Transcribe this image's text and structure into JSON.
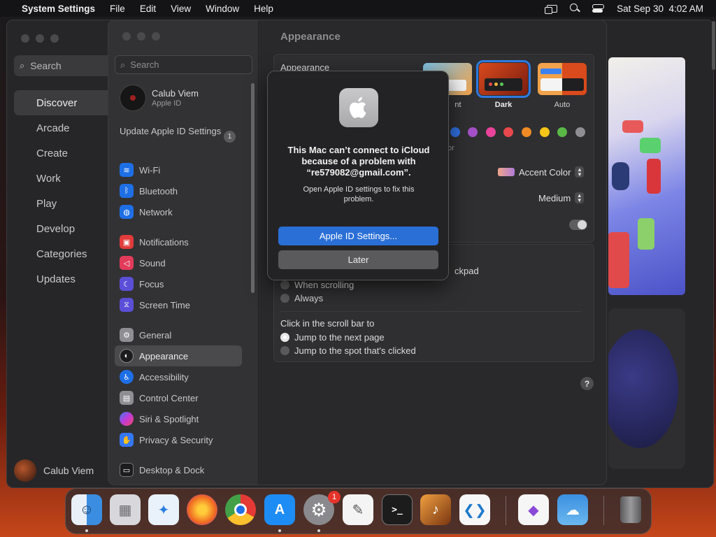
{
  "menubar": {
    "app_name": "System Settings",
    "menus": [
      "File",
      "Edit",
      "View",
      "Window",
      "Help"
    ],
    "datetime": "Sat Sep 30  4:02 AM"
  },
  "appstore": {
    "search_placeholder": "Search",
    "nav": [
      "Discover",
      "Arcade",
      "Create",
      "Work",
      "Play",
      "Develop",
      "Categories",
      "Updates"
    ],
    "active": "Discover",
    "user_name": "Calub Viem"
  },
  "settings": {
    "search_placeholder": "Search",
    "user": {
      "name": "Calub Viem",
      "sub": "Apple ID"
    },
    "update": {
      "label": "Update Apple ID Settings",
      "count": "1"
    },
    "groups": [
      [
        {
          "label": "Wi-Fi",
          "icon": "wifi-icon",
          "color": "#1e6fe6"
        },
        {
          "label": "Bluetooth",
          "icon": "bluetooth-icon",
          "color": "#1e6fe6"
        },
        {
          "label": "Network",
          "icon": "network-icon",
          "color": "#1e6fe6"
        }
      ],
      [
        {
          "label": "Notifications",
          "icon": "notifications-icon",
          "color": "#e23b3b"
        },
        {
          "label": "Sound",
          "icon": "sound-icon",
          "color": "#e23b5a"
        },
        {
          "label": "Focus",
          "icon": "focus-icon",
          "color": "#5b4fd8"
        },
        {
          "label": "Screen Time",
          "icon": "screen-time-icon",
          "color": "#5b4fd8"
        }
      ],
      [
        {
          "label": "General",
          "icon": "general-icon",
          "color": "#8e8e93"
        },
        {
          "label": "Appearance",
          "icon": "appearance-icon",
          "color": "#1c1c1e"
        },
        {
          "label": "Accessibility",
          "icon": "accessibility-icon",
          "color": "#1e6fe6"
        },
        {
          "label": "Control Center",
          "icon": "control-center-icon",
          "color": "#8e8e93"
        },
        {
          "label": "Siri & Spotlight",
          "icon": "siri-icon",
          "color": "#b33ad6"
        },
        {
          "label": "Privacy & Security",
          "icon": "privacy-icon",
          "color": "#3478f6"
        }
      ],
      [
        {
          "label": "Desktop & Dock",
          "icon": "desktop-dock-icon",
          "color": "#1c1c1e"
        }
      ]
    ],
    "active": "Appearance",
    "main": {
      "title": "Appearance",
      "appearance_label": "Appearance",
      "themes": [
        {
          "label": "nt",
          "selected": false
        },
        {
          "label": "Dark",
          "selected": true
        },
        {
          "label": "Auto",
          "selected": false
        }
      ],
      "accent_colors": [
        "#2f6fe0",
        "#a550c8",
        "#e9449a",
        "#e8484b",
        "#f08a24",
        "#f5c518",
        "#5ab847",
        "#8e8e93"
      ],
      "accent_partial": "or",
      "highlight_label": "Accent Color",
      "sidebar_size_value": "Medium",
      "scroll_partial": "ckpad",
      "scroll_options": [
        "When scrolling",
        "Always"
      ],
      "click_title": "Click in the scroll bar to",
      "click_options": [
        {
          "label": "Jump to the next page",
          "selected": true
        },
        {
          "label": "Jump to the spot that's clicked",
          "selected": false
        }
      ],
      "help": "?"
    }
  },
  "dialog": {
    "title": "This Mac can’t connect to iCloud because of a problem with “re579082@gmail.com”.",
    "message": "Open Apple ID settings to fix this problem.",
    "primary_button": "Apple ID Settings...",
    "secondary_button": "Later"
  },
  "dock": {
    "apps": [
      {
        "name": "finder",
        "color": "#3a8de0",
        "glyph": "☺"
      },
      {
        "name": "launchpad",
        "color": "#d8d8dc",
        "glyph": "▦"
      },
      {
        "name": "safari",
        "color": "#e9f2fb",
        "glyph": "✦"
      },
      {
        "name": "firefox",
        "color": "#f06a21",
        "glyph": "●"
      },
      {
        "name": "chrome",
        "color": "#f2f2f2",
        "glyph": "◉"
      },
      {
        "name": "app-store",
        "color": "#1e8cf5",
        "glyph": "A"
      },
      {
        "name": "system-settings",
        "color": "#8a8a8e",
        "glyph": "⚙"
      },
      {
        "name": "textedit",
        "color": "#f4f4f4",
        "glyph": "✎"
      },
      {
        "name": "terminal",
        "color": "#1c1c1c",
        "glyph": ">_"
      },
      {
        "name": "garageband",
        "color": "#e07a1c",
        "glyph": "♪"
      },
      {
        "name": "vscode",
        "color": "#f7f7f7",
        "glyph": "❮❯"
      },
      {
        "name": "visual-studio",
        "color": "#f6f6f6",
        "glyph": "◆"
      },
      {
        "name": "weather",
        "color": "#3b8fe0",
        "glyph": "☁"
      },
      {
        "name": "trash",
        "color": "#6e6e70",
        "glyph": "🗑"
      }
    ],
    "badge": "1"
  }
}
